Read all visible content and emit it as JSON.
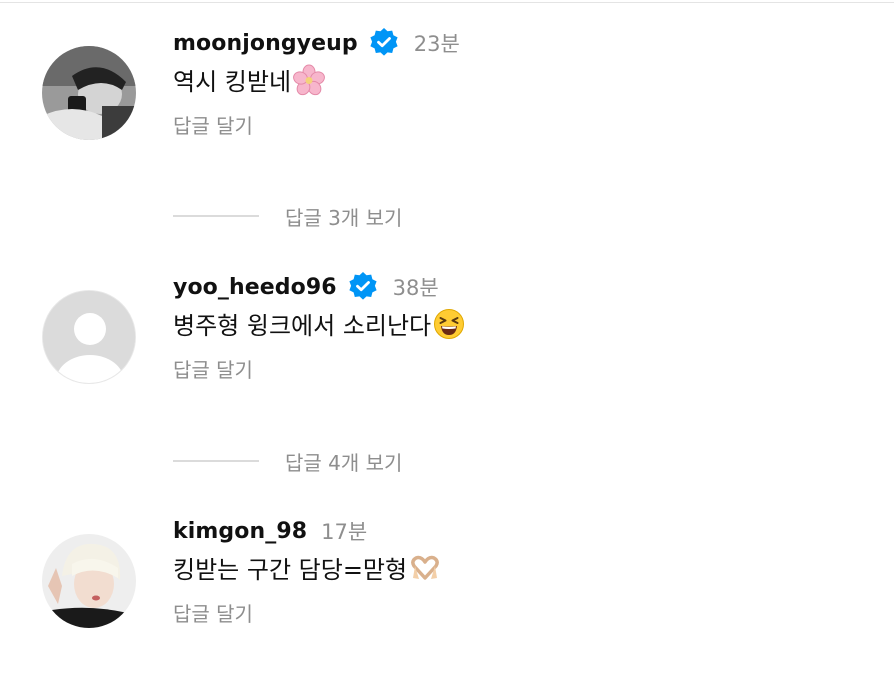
{
  "comments": [
    {
      "username": "moonjongyeup",
      "verified": true,
      "time": "23분",
      "text": "역시 킹받네",
      "emoji": "cherry-blossom",
      "reply_label": "답글 달기",
      "more_replies": "답글 3개 보기"
    },
    {
      "username": "yoo_heedo96",
      "verified": true,
      "time": "38분",
      "text": "병주형 윙크에서 소리난다",
      "emoji": "squinting-laughing-face",
      "reply_label": "답글 달기",
      "more_replies": "답글 4개 보기"
    },
    {
      "username": "kimgon_98",
      "verified": false,
      "time": "17분",
      "text": "킹받는 구간 담당=맏형",
      "emoji": "heart-hands",
      "reply_label": "답글 달기"
    }
  ],
  "colors": {
    "verified_badge": "#0095f6",
    "secondary_text": "#8e8e8e",
    "divider": "#dbdbdb"
  }
}
